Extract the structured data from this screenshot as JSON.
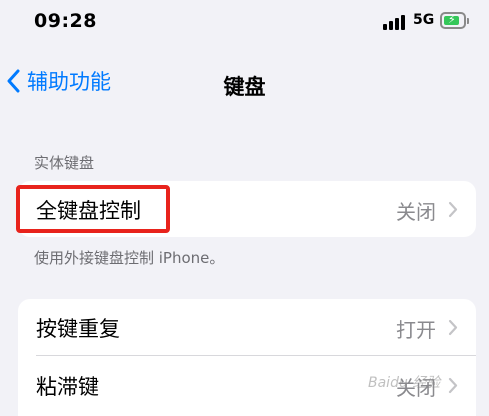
{
  "status_bar": {
    "time": "09:28",
    "network": "5G",
    "battery_charging": true
  },
  "nav": {
    "back_label": "辅助功能",
    "title": "键盘"
  },
  "section1": {
    "header": "实体键盘",
    "rows": [
      {
        "label": "全键盘控制",
        "value": "关闭"
      }
    ],
    "footer": "使用外接键盘控制 iPhone。"
  },
  "section2": {
    "rows": [
      {
        "label": "按键重复",
        "value": "打开"
      },
      {
        "label": "粘滞键",
        "value": "关闭"
      }
    ]
  },
  "watermark": "Baidu 经验",
  "colors": {
    "accent": "#007aff",
    "highlight": "#e8231c",
    "battery": "#34c759",
    "background": "#f2f2f7"
  }
}
